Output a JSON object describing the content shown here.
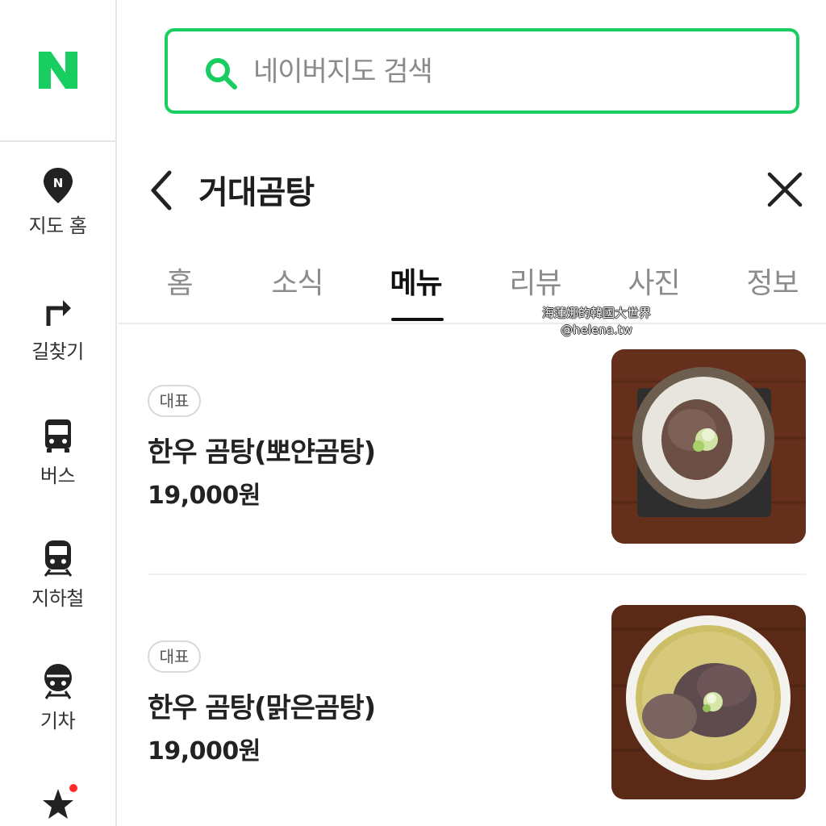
{
  "brand": {
    "logo_letter": "N",
    "accent": "#19ce60"
  },
  "sidebar": {
    "items": [
      {
        "label": "지도 홈",
        "icon": "map-pin-icon"
      },
      {
        "label": "길찾기",
        "icon": "directions-arrow-icon"
      },
      {
        "label": "버스",
        "icon": "bus-icon"
      },
      {
        "label": "지하철",
        "icon": "subway-icon"
      },
      {
        "label": "기차",
        "icon": "train-icon"
      },
      {
        "label": "",
        "icon": "star-icon",
        "has_notification": true
      }
    ]
  },
  "search": {
    "placeholder": "네이버지도 검색",
    "value": ""
  },
  "header": {
    "title": "거대곰탕"
  },
  "tabs": [
    {
      "label": "홈",
      "active": false
    },
    {
      "label": "소식",
      "active": false
    },
    {
      "label": "메뉴",
      "active": true
    },
    {
      "label": "리뷰",
      "active": false
    },
    {
      "label": "사진",
      "active": false
    },
    {
      "label": "정보",
      "active": false
    }
  ],
  "watermark": {
    "line1": "海蓮娜的韓國大世界",
    "line2": "@helena.tw"
  },
  "menu": [
    {
      "badge": "대표",
      "name": "한우 곰탕(뽀얀곰탕)",
      "price": "19,000원",
      "image": "milky-gomtang-photo"
    },
    {
      "badge": "대표",
      "name": "한우 곰탕(맑은곰탕)",
      "price": "19,000원",
      "image": "clear-gomtang-photo"
    }
  ]
}
